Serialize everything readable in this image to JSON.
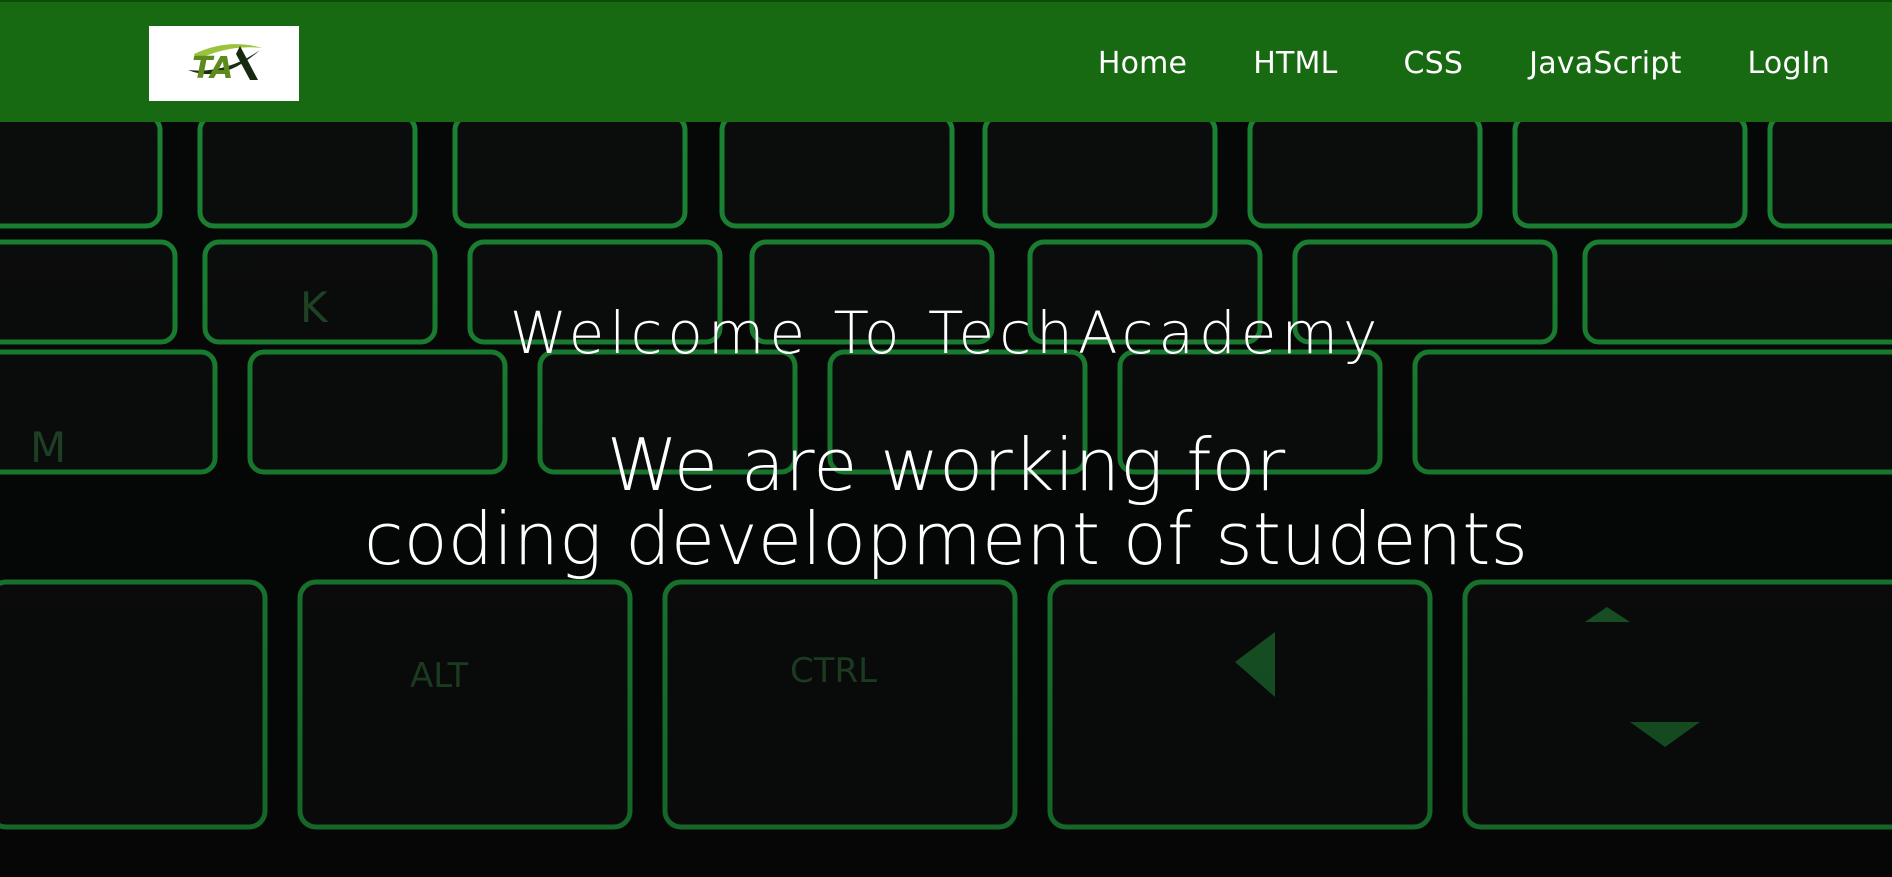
{
  "header": {
    "logo_text": "TA",
    "logo_icon": "techacademy-logo-icon",
    "brand_color": "#186a12",
    "nav": [
      {
        "label": "Home"
      },
      {
        "label": "HTML"
      },
      {
        "label": "CSS"
      },
      {
        "label": "JavaScript"
      },
      {
        "label": "LogIn"
      }
    ]
  },
  "hero": {
    "title": "Welcome To TechAcademy",
    "tagline_line1": "We are working for",
    "tagline_line2": "coding development of students",
    "background": "keyboard-backlit-green-image"
  }
}
